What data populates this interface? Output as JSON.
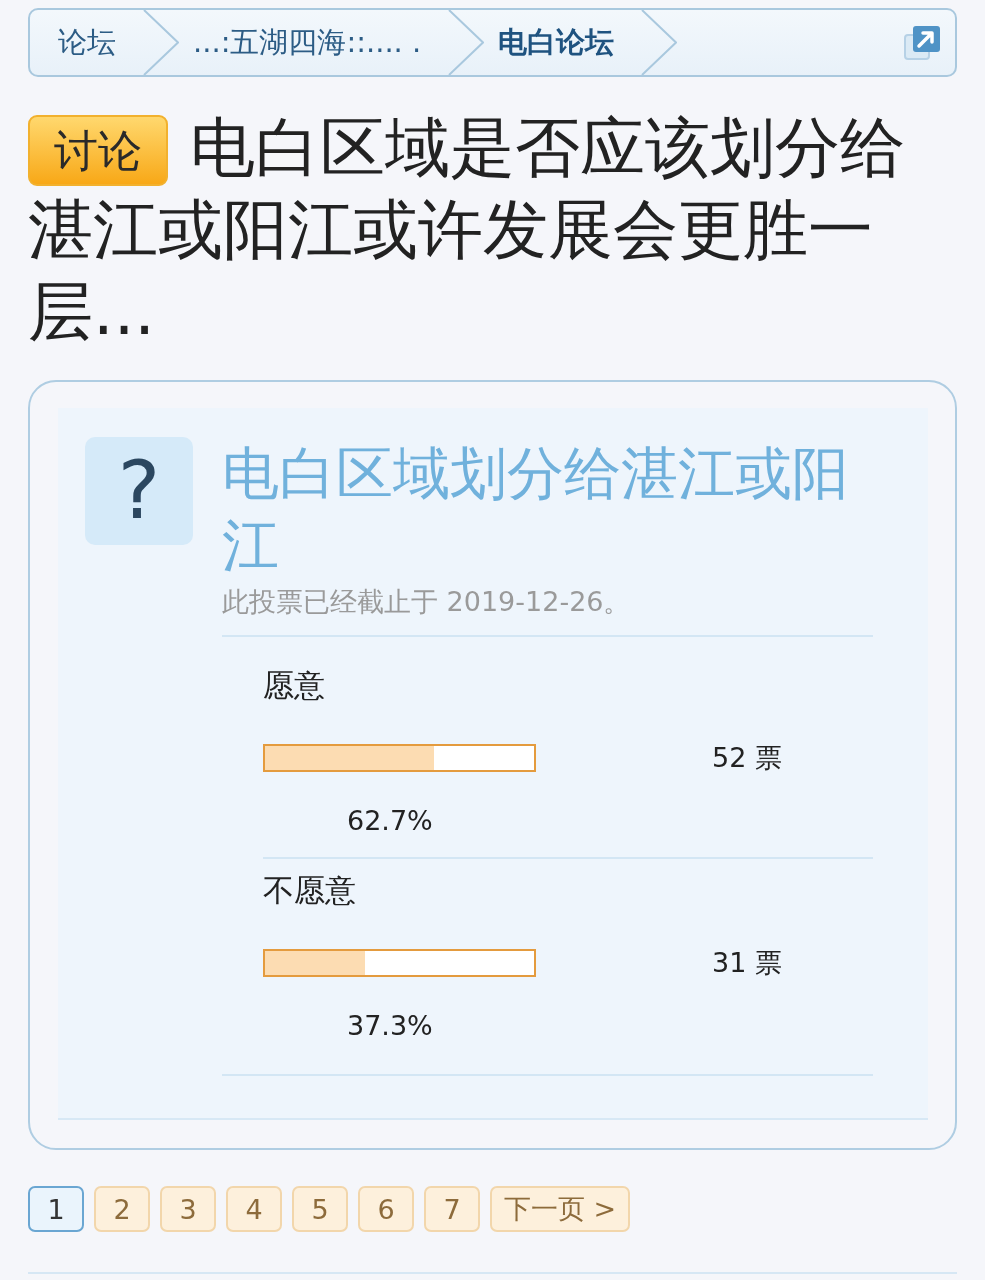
{
  "breadcrumb": {
    "items": [
      {
        "label": "论坛",
        "current": false
      },
      {
        "label": "...:五湖四海::.... .",
        "current": false
      },
      {
        "label": "电白论坛",
        "current": true
      }
    ]
  },
  "thread": {
    "tag": "讨论",
    "title": "电白区域是否应该划分给湛江或阳江或许发展会更胜一层..."
  },
  "poll": {
    "icon": "?",
    "question": "电白区域划分给湛江或阳江",
    "status": "此投票已经截止于 2019-12-26。",
    "options": [
      {
        "label": "愿意",
        "level": 0.627,
        "votes": "52 票",
        "percent": "62.7%"
      },
      {
        "label": "不愿意",
        "level": 0.373,
        "votes": "31 票",
        "percent": "37.3%"
      }
    ]
  },
  "pagination": {
    "pages": [
      {
        "label": "1",
        "selected": true
      },
      {
        "label": "2",
        "selected": false
      },
      {
        "label": "3",
        "selected": false
      },
      {
        "label": "4",
        "selected": false
      },
      {
        "label": "5",
        "selected": false
      },
      {
        "label": "6",
        "selected": false
      },
      {
        "label": "7",
        "selected": false
      }
    ],
    "next": "下一页 >"
  }
}
